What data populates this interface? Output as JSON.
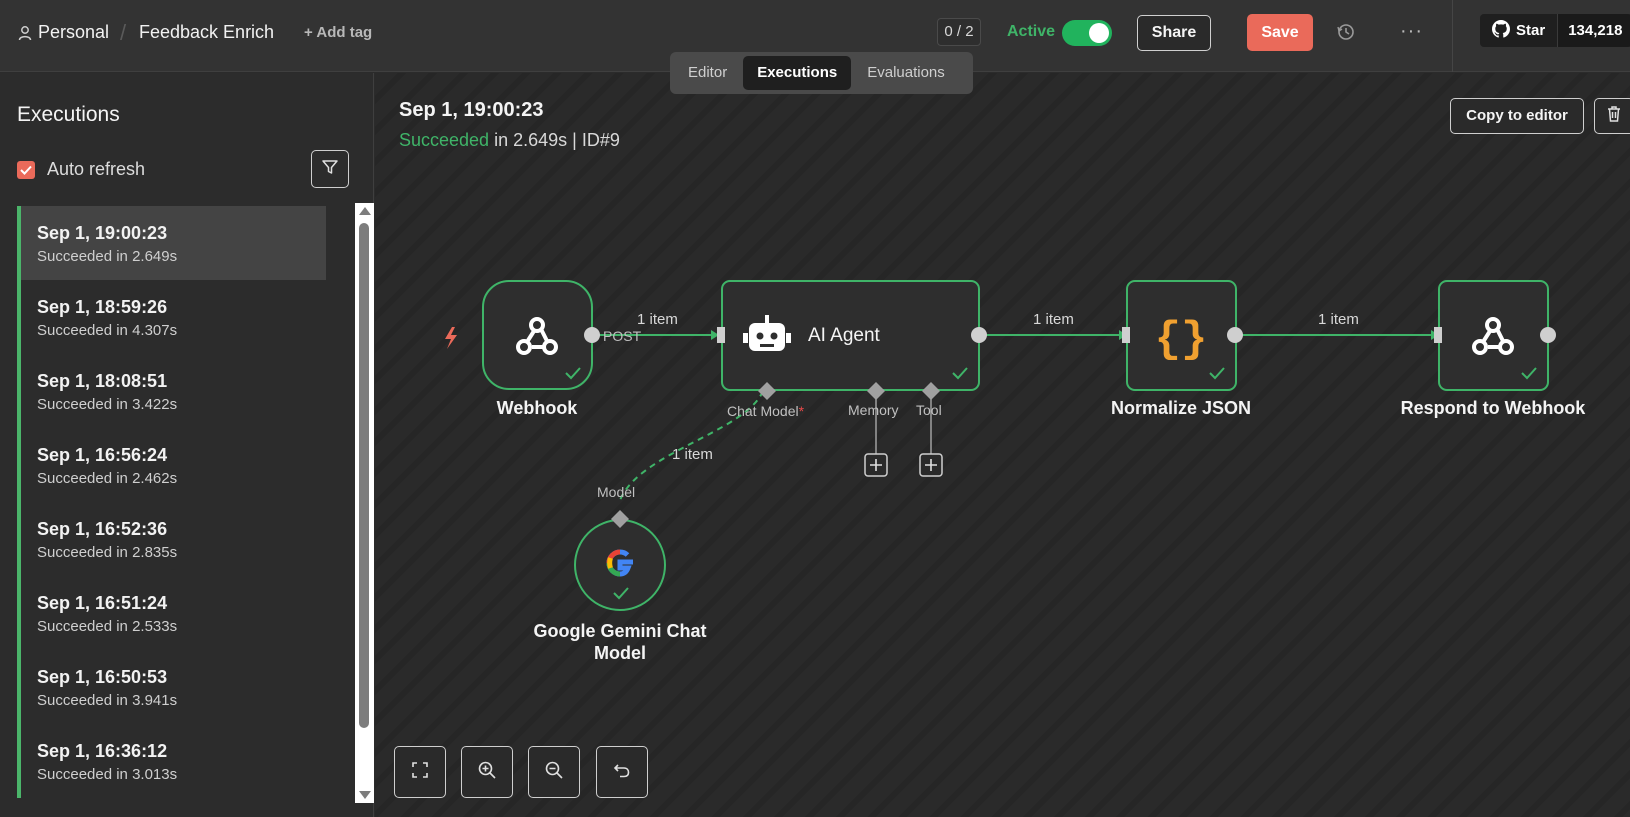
{
  "header": {
    "project": "Personal",
    "workflow": "Feedback Enrich",
    "add_tag": "+ Add tag",
    "counter": "0 / 2",
    "active_label": "Active",
    "share_label": "Share",
    "save_label": "Save",
    "github_star": "Star",
    "github_count": "134,218"
  },
  "tabs": [
    "Editor",
    "Executions",
    "Evaluations"
  ],
  "sidebar": {
    "title": "Executions",
    "auto_refresh": "Auto refresh",
    "executions": [
      {
        "time": "Sep 1, 19:00:23",
        "status": "Succeeded in 2.649s"
      },
      {
        "time": "Sep 1, 18:59:26",
        "status": "Succeeded in 4.307s"
      },
      {
        "time": "Sep 1, 18:08:51",
        "status": "Succeeded in 3.422s"
      },
      {
        "time": "Sep 1, 16:56:24",
        "status": "Succeeded in 2.462s"
      },
      {
        "time": "Sep 1, 16:52:36",
        "status": "Succeeded in 2.835s"
      },
      {
        "time": "Sep 1, 16:51:24",
        "status": "Succeeded in 2.533s"
      },
      {
        "time": "Sep 1, 16:50:53",
        "status": "Succeeded in 3.941s"
      },
      {
        "time": "Sep 1, 16:36:12",
        "status": "Succeeded in 3.013s"
      }
    ]
  },
  "execution": {
    "time": "Sep 1, 19:00:23",
    "status": "Succeeded",
    "details": "in 2.649s | ID#9",
    "copy_label": "Copy to editor"
  },
  "workflow": {
    "nodes": {
      "webhook": "Webhook",
      "agent": "AI Agent",
      "normalize": "Normalize JSON",
      "respond": "Respond to Webhook",
      "gemini_line1": "Google Gemini Chat",
      "gemini_line2": "Model"
    },
    "labels": {
      "post": "POST",
      "item": "1 item",
      "chat_model": "Chat Model",
      "required_mark": "*",
      "memory": "Memory",
      "tool": "Tool",
      "model": "Model"
    }
  },
  "colors": {
    "accent": "#ea6a5a",
    "success": "#3fb468",
    "node_border": "#3fb468"
  }
}
